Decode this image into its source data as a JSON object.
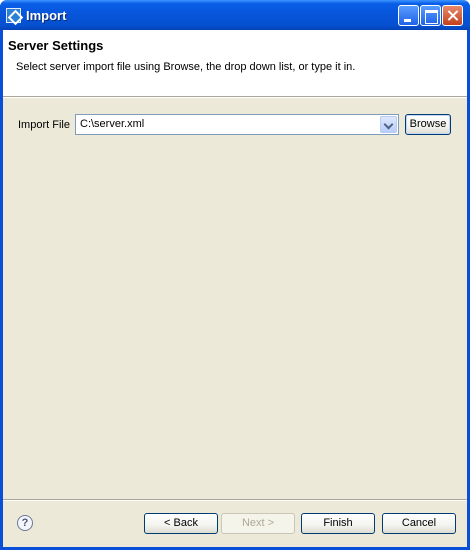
{
  "window": {
    "title": "Import"
  },
  "header": {
    "title": "Server Settings",
    "description": "Select server import file using Browse, the drop down list, or type it in."
  },
  "form": {
    "import_file_label": "Import File",
    "import_file_value": "C:\\server.xml",
    "browse_label": "Browse"
  },
  "footer": {
    "help_glyph": "?",
    "back_label": "< Back",
    "next_label": "Next >",
    "next_enabled": false,
    "finish_label": "Finish",
    "cancel_label": "Cancel"
  },
  "icons": {
    "app": "eclipse-import-icon",
    "help": "help-icon",
    "dropdown": "chevron-down-icon"
  },
  "colors": {
    "titlebar": "#0a5ee8",
    "dialog_background": "#ece9d8",
    "header_background": "#ffffff",
    "button_border": "#003c74"
  }
}
